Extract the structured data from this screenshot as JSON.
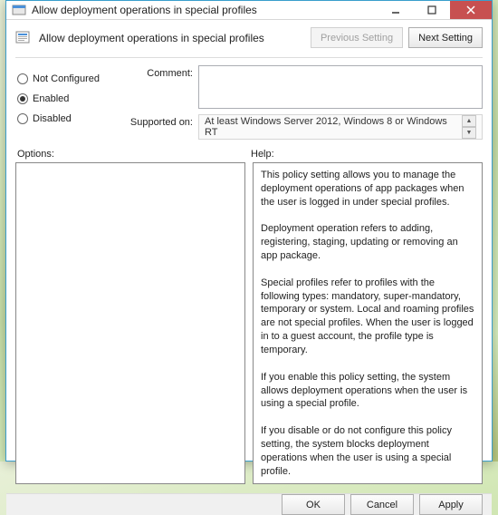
{
  "window": {
    "title": "Allow deployment operations in special profiles"
  },
  "header": {
    "title": "Allow deployment operations in special profiles",
    "prev_btn": "Previous Setting",
    "next_btn": "Next Setting"
  },
  "radios": {
    "not_configured": "Not Configured",
    "enabled": "Enabled",
    "disabled": "Disabled",
    "selected": "enabled"
  },
  "fields": {
    "comment_label": "Comment:",
    "comment_value": "",
    "supported_label": "Supported on:",
    "supported_value": "At least Windows Server 2012, Windows 8 or Windows RT"
  },
  "panes": {
    "options_label": "Options:",
    "help_label": "Help:",
    "help_text": "This policy setting allows you to manage the deployment operations of app packages when the user is logged in under special profiles.\n\nDeployment operation refers to adding, registering, staging, updating or removing an app package.\n\nSpecial profiles refer to profiles with the following types: mandatory, super-mandatory, temporary or system. Local and roaming profiles are not special profiles. When the user is logged in to a guest account, the profile type is temporary.\n\nIf you enable this policy setting, the system allows deployment operations when the user is using a special profile.\n\nIf you disable or do not configure this policy setting, the system blocks deployment operations when the user is using a special profile."
  },
  "footer": {
    "ok": "OK",
    "cancel": "Cancel",
    "apply": "Apply"
  }
}
